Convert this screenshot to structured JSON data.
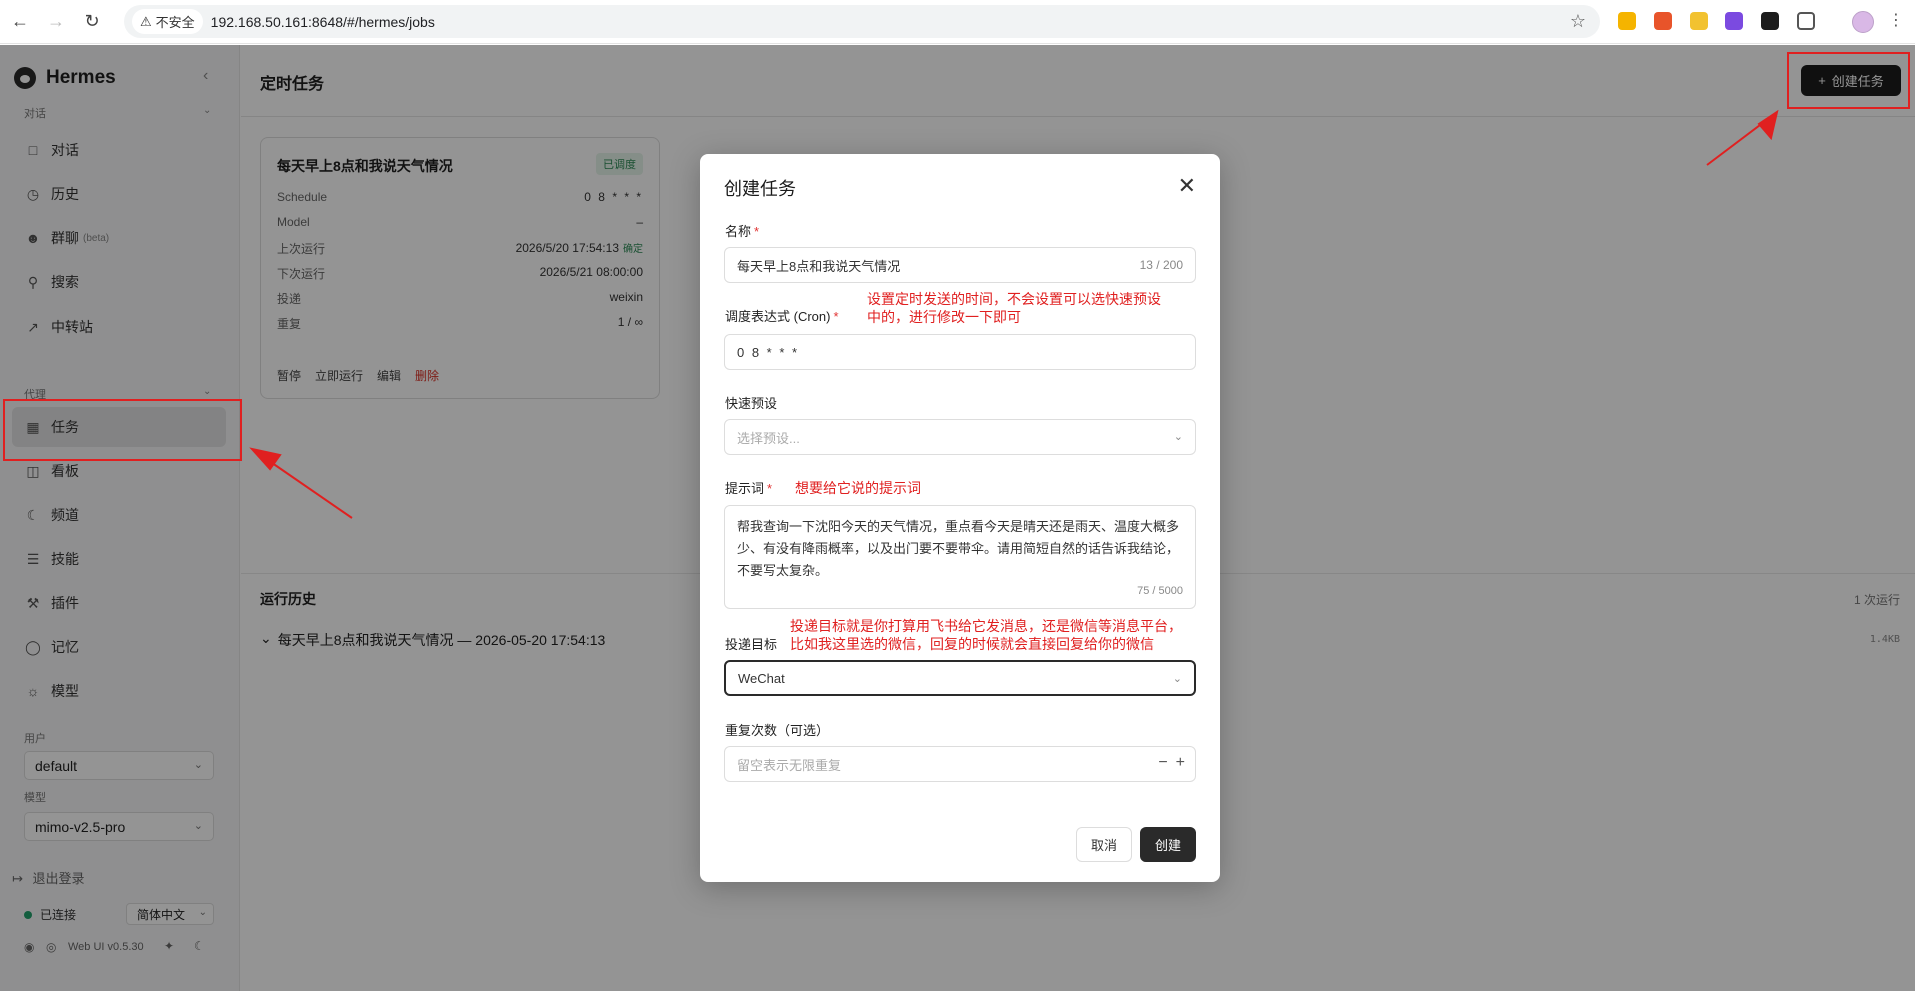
{
  "browser": {
    "insecure_label": "不安全",
    "url": "192.168.50.161:8648/#/hermes/jobs"
  },
  "sidebar": {
    "brand": "Hermes",
    "section_chat": "对话",
    "items": [
      {
        "label": "对话",
        "icon": "chat-icon"
      },
      {
        "label": "历史",
        "icon": "clock-icon"
      },
      {
        "label": "群聊",
        "icon": "users-icon",
        "badge": "(beta)"
      },
      {
        "label": "搜索",
        "icon": "search-icon"
      },
      {
        "label": "中转站",
        "icon": "external-link-icon"
      }
    ],
    "section_agent": "代理",
    "agent_items": [
      {
        "label": "任务",
        "icon": "calendar-icon"
      },
      {
        "label": "看板",
        "icon": "board-icon"
      },
      {
        "label": "频道",
        "icon": "moon-icon"
      },
      {
        "label": "技能",
        "icon": "layers-icon"
      },
      {
        "label": "插件",
        "icon": "wrench-icon"
      },
      {
        "label": "记忆",
        "icon": "bulb-icon"
      },
      {
        "label": "模型",
        "icon": "sun-icon"
      }
    ],
    "user_label": "用户",
    "user_value": "default",
    "model_label": "模型",
    "model_value": "mimo-v2.5-pro",
    "logout": "退出登录",
    "status": "已连接",
    "language": "简体中文",
    "version": "Web UI v0.5.30"
  },
  "main": {
    "title": "定时任务",
    "create_button": "创建任务",
    "job": {
      "title": "每天早上8点和我说天气情况",
      "status": "已调度",
      "rows": [
        {
          "key": "Schedule",
          "value": "0 8 * * *"
        },
        {
          "key": "Model",
          "value": "–"
        },
        {
          "key": "上次运行",
          "value": "2026/5/20 17:54:13",
          "extra": "确定"
        },
        {
          "key": "下次运行",
          "value": "2026/5/21 08:00:00"
        },
        {
          "key": "投递",
          "value": "weixin"
        },
        {
          "key": "重复",
          "value": "1 / ∞"
        }
      ],
      "actions": {
        "pause": "暂停",
        "run_now": "立即运行",
        "edit": "编辑",
        "delete": "删除"
      }
    },
    "history": {
      "title": "运行历史",
      "count": "1 次运行",
      "item": "每天早上8点和我说天气情况 — 2026-05-20 17:54:13",
      "size": "1.4KB"
    }
  },
  "modal": {
    "title": "创建任务",
    "name_label": "名称",
    "name_value": "每天早上8点和我说天气情况",
    "name_counter": "13 / 200",
    "cron_label": "调度表达式 (Cron)",
    "cron_value": "0 8 * * *",
    "preset_label": "快速预设",
    "preset_placeholder": "选择预设...",
    "prompt_label": "提示词",
    "prompt_value": "帮我查询一下沈阳今天的天气情况，重点看今天是晴天还是雨天、温度大概多少、有没有降雨概率，以及出门要不要带伞。请用简短自然的话告诉我结论，不要写太复杂。",
    "prompt_counter": "75 / 5000",
    "target_label": "投递目标",
    "target_value": "WeChat",
    "repeat_label": "重复次数（可选）",
    "repeat_placeholder": "留空表示无限重复",
    "cancel": "取消",
    "create": "创建"
  },
  "annotations": {
    "cron_note_1": "设置定时发送的时间，不会设置可以选快速预设",
    "cron_note_2": "中的，进行修改一下即可",
    "prompt_note": "想要给它说的提示词",
    "target_note_1": "投递目标就是你打算用飞书给它发消息，还是微信等消息平台，",
    "target_note_2": "比如我这里选的微信，回复的时候就会直接回复给你的微信",
    "color": "#e02020"
  }
}
